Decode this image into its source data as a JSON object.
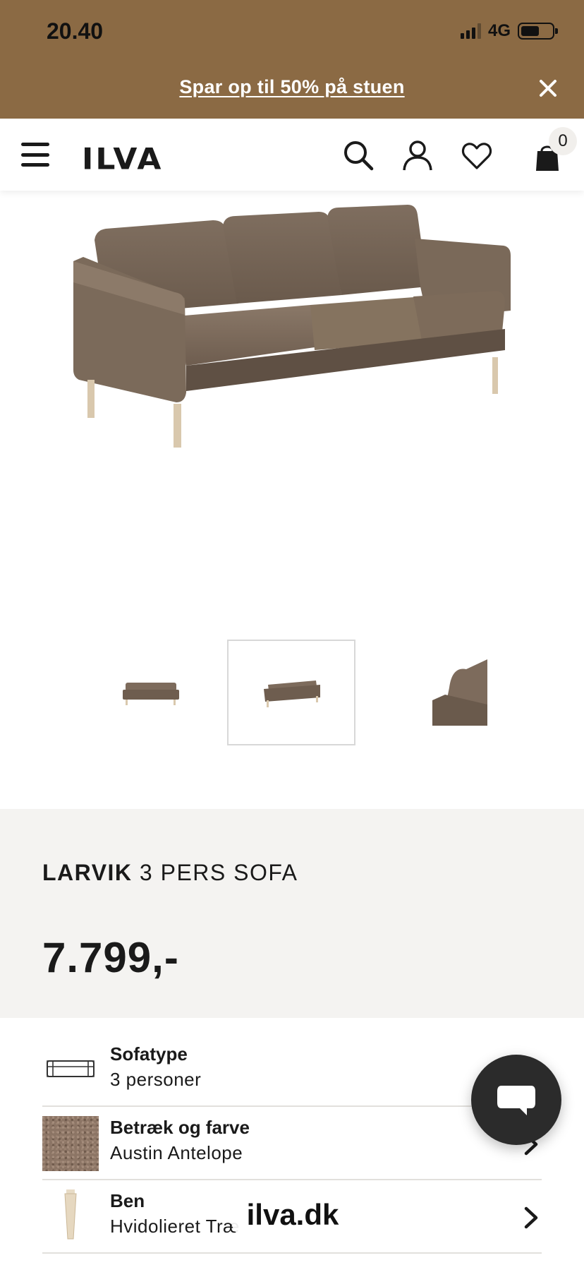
{
  "status_bar": {
    "time": "20.40",
    "network": "4G"
  },
  "promo": {
    "text": "Spar op til 50% på stuen"
  },
  "header": {
    "logo": "ILVA",
    "cart_count": "0"
  },
  "product": {
    "name_bold": "LARVIK",
    "name_rest": "3 PERS SOFA",
    "price": "7.799,-"
  },
  "options": [
    {
      "label": "Sofatype",
      "value": "3 personer",
      "icon": "sofa-outline-icon"
    },
    {
      "label": "Betræk og farve",
      "value": "Austin Antelope",
      "icon": "fabric-swatch"
    },
    {
      "label": "Ben",
      "value": "Hvidolieret Træ",
      "icon": "wooden-leg"
    }
  ],
  "browser": {
    "url": "ilva.dk"
  },
  "colors": {
    "banner": "#8b6a44",
    "info_bg": "#f4f3f1",
    "sofa": "#7d6b5c",
    "chat": "#2b2b2b"
  }
}
